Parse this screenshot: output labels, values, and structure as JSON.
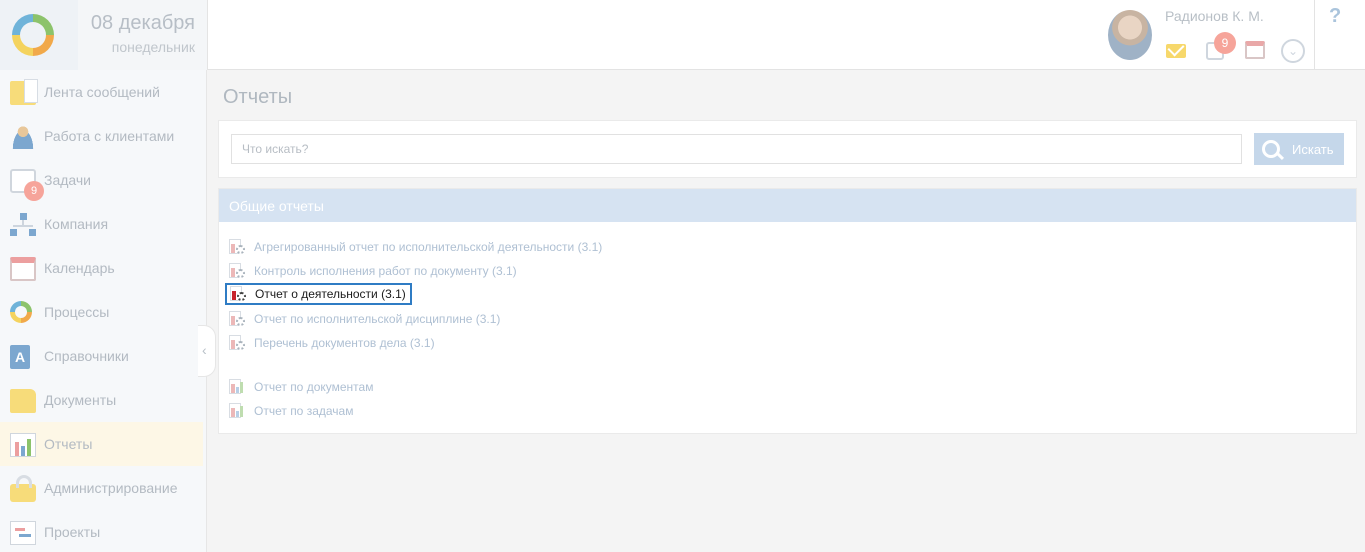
{
  "header": {
    "date_day": "08 декабря",
    "date_weekday": "понедельник",
    "user_name": "Радионов К. М.",
    "tasks_badge": "9",
    "help": "?"
  },
  "sidebar": {
    "items": [
      {
        "label": "Лента сообщений",
        "icon": "messages-icon"
      },
      {
        "label": "Работа с клиентами",
        "icon": "clients-icon"
      },
      {
        "label": "Задачи",
        "icon": "tasks-icon",
        "badge": "9"
      },
      {
        "label": "Компания",
        "icon": "company-icon"
      },
      {
        "label": "Календарь",
        "icon": "calendar-icon"
      },
      {
        "label": "Процессы",
        "icon": "processes-icon"
      },
      {
        "label": "Справочники",
        "icon": "directories-icon",
        "glyph": "A"
      },
      {
        "label": "Документы",
        "icon": "documents-icon"
      },
      {
        "label": "Отчеты",
        "icon": "reports-icon",
        "active": true
      },
      {
        "label": "Администрирование",
        "icon": "admin-icon"
      },
      {
        "label": "Проекты",
        "icon": "projects-icon"
      }
    ]
  },
  "main": {
    "title": "Отчеты",
    "search": {
      "placeholder": "Что искать?",
      "button_label": "Искать"
    },
    "section_title": "Общие отчеты",
    "reports": [
      {
        "label": "Агрегированный отчет по исполнительской деятельности (3.1)",
        "icon": "report-settings-icon"
      },
      {
        "label": "Контроль исполнения работ по документу (3.1)",
        "icon": "report-settings-icon"
      },
      {
        "label": "Отчет о деятельности (3.1)",
        "icon": "report-settings-icon",
        "selected": true
      },
      {
        "label": "Отчет по исполнительской дисциплине (3.1)",
        "icon": "report-settings-icon"
      },
      {
        "label": "Перечень документов дела (3.1)",
        "icon": "report-settings-icon"
      },
      {
        "label": "Отчет по документам",
        "icon": "report-chart-icon"
      },
      {
        "label": "Отчет по задачам",
        "icon": "report-chart-icon"
      }
    ]
  },
  "colors": {
    "selection_border": "#2f7cc4",
    "section_header": "#d6e3f2",
    "badge": "#f6a49a",
    "active_nav": "#fdf7e6"
  }
}
